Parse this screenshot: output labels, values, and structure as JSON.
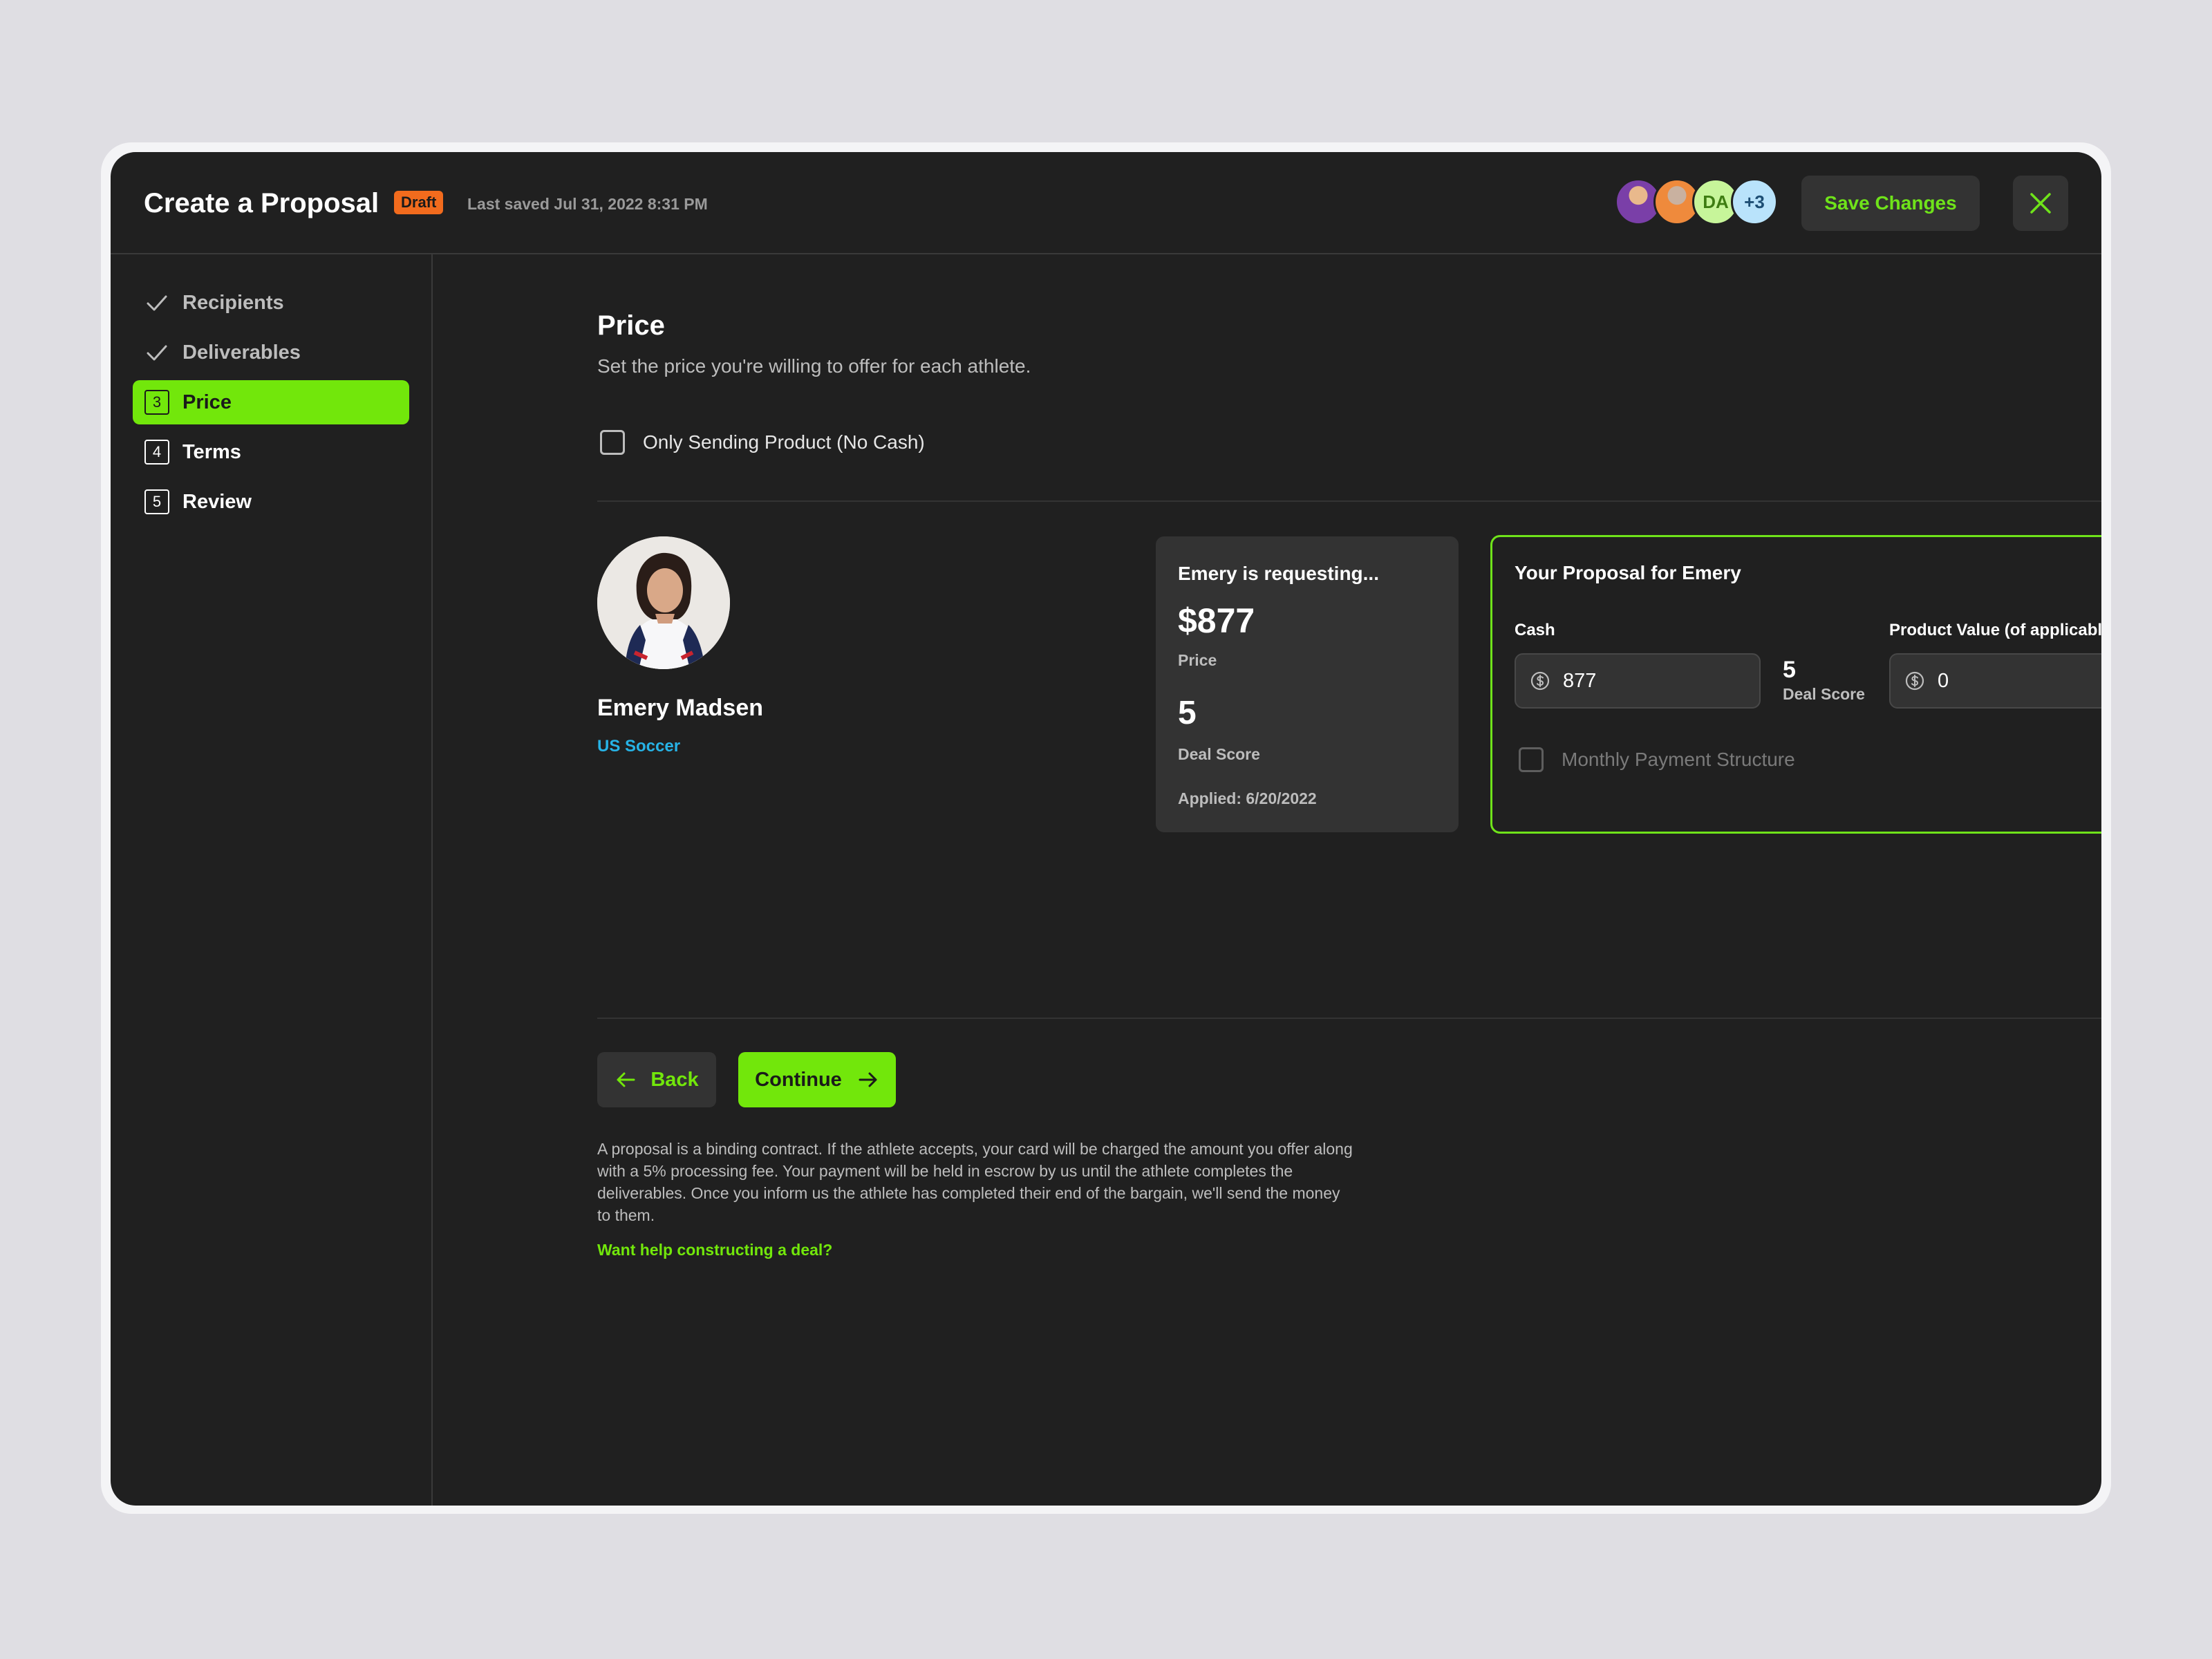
{
  "header": {
    "title": "Create a Proposal",
    "badge": "Draft",
    "last_saved": "Last saved Jul 31, 2022 8:31 PM",
    "avatars": [
      {
        "name": "user-avatar-1",
        "initials": ""
      },
      {
        "name": "user-avatar-2",
        "initials": ""
      },
      {
        "name": "user-avatar-3",
        "initials": "DA"
      },
      {
        "name": "more-avatars",
        "initials": "+3"
      }
    ],
    "save_label": "Save Changes",
    "close_icon": "close-icon"
  },
  "sidebar": {
    "steps": [
      {
        "num": "",
        "label": "Recipients",
        "state": "done",
        "icon": "check-icon"
      },
      {
        "num": "",
        "label": "Deliverables",
        "state": "done",
        "icon": "check-icon"
      },
      {
        "num": "3",
        "label": "Price",
        "state": "active"
      },
      {
        "num": "4",
        "label": "Terms",
        "state": "todo"
      },
      {
        "num": "5",
        "label": "Review",
        "state": "todo"
      }
    ]
  },
  "main": {
    "title": "Price",
    "subtitle": "Set the price you're willing to offer for each athlete.",
    "no_cash_label": "Only Sending Product (No Cash)",
    "athlete": {
      "name": "Emery Madsen",
      "team": "US Soccer"
    },
    "request": {
      "title": "Emery is requesting...",
      "price": "$877",
      "price_label": "Price",
      "deal_score": "5",
      "deal_score_label": "Deal Score",
      "applied": "Applied: 6/20/2022"
    },
    "proposal": {
      "title": "Your Proposal for Emery",
      "cash_label": "Cash",
      "cash_value": "877",
      "deal_score": "5",
      "deal_score_label": "Deal Score",
      "product_label": "Product Value (of applicable)",
      "product_value": "0",
      "monthly_label": "Monthly Payment Structure"
    },
    "back_label": "Back",
    "continue_label": "Continue",
    "disclaimer": "A proposal is a binding contract. If the athlete accepts, your card will be charged the amount you offer along with a 5% processing fee. Your payment will be held in escrow by us until the athlete completes the deliverables. Once you inform us the athlete has completed their end of the bargain, we'll send the money to them.",
    "help_link": "Want help constructing a deal?"
  },
  "colors": {
    "accent": "#72e70b",
    "badge": "#f26b1d",
    "team_link": "#27b3e6",
    "background": "#202020"
  }
}
